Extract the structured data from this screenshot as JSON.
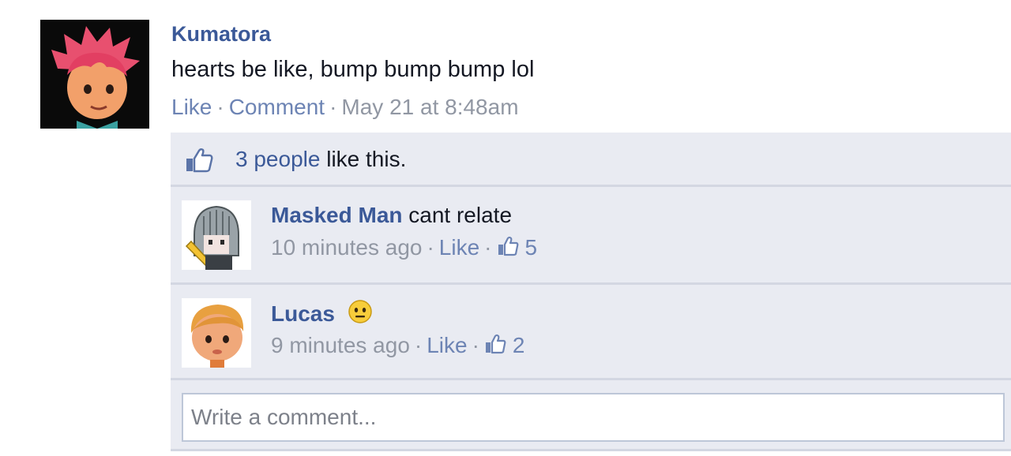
{
  "post": {
    "author": "Kumatora",
    "text": "hearts be like, bump bump bump lol",
    "actions": {
      "like": "Like",
      "comment": "Comment",
      "separator": "·",
      "timestamp": "May 21 at 8:48am"
    }
  },
  "likes_summary": {
    "count_text": "3 people",
    "suffix": " like this.",
    "icon": "thumbs-up-icon"
  },
  "comments": [
    {
      "author": "Masked Man",
      "text": "cant relate",
      "time": "10 minutes ago",
      "like_label": "Like",
      "like_count": "5"
    },
    {
      "author": "Lucas",
      "text": "",
      "emoji": "neutral-face-emoji",
      "time": "9 minutes ago",
      "like_label": "Like",
      "like_count": "2"
    }
  ],
  "comment_box": {
    "placeholder": "Write a comment..."
  },
  "colors": {
    "link": "#3b5998",
    "muted_link": "#6d84b4",
    "meta": "#9197a3",
    "panel": "#e9ebf2"
  }
}
